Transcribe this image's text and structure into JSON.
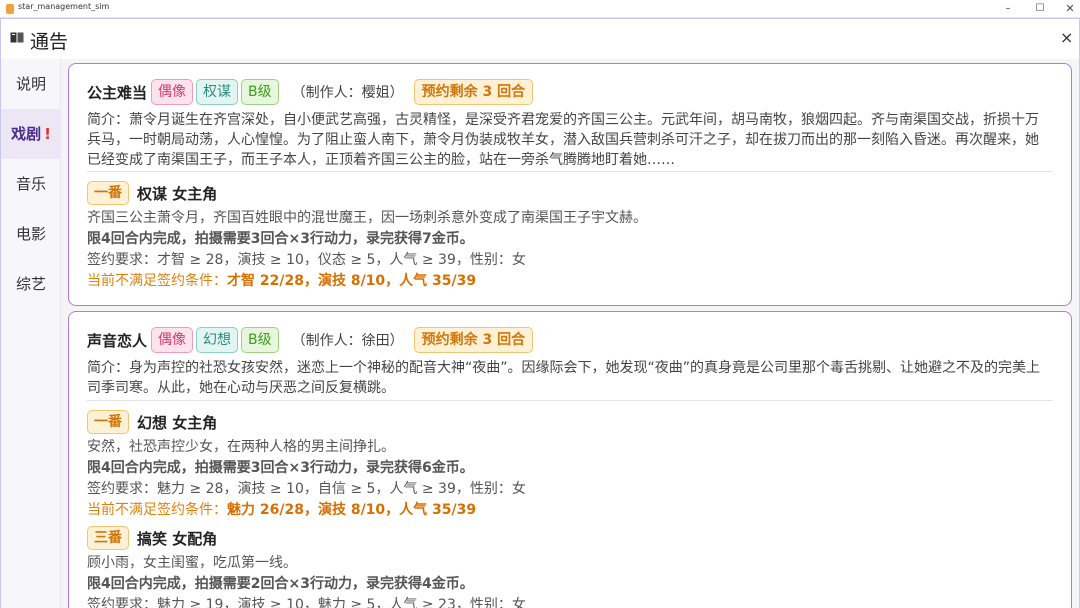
{
  "window": {
    "title": "star_management_sim",
    "minimize": "–",
    "maximize": "☐",
    "close": "✕"
  },
  "header": {
    "title": "通告",
    "close": "×"
  },
  "sidebar": {
    "items": [
      {
        "label": "说明"
      },
      {
        "label": "戏剧",
        "alert": "!"
      },
      {
        "label": "音乐"
      },
      {
        "label": "电影"
      },
      {
        "label": "综艺"
      }
    ]
  },
  "cards": [
    {
      "title": "公主难当",
      "tags": [
        "偶像",
        "权谋",
        "B级"
      ],
      "maker": "（制作人：樱姐）",
      "reserve": "预约剩余 3 回合",
      "description": "简介：萧令月诞生在齐宫深处，自小便武艺高强，古灵精怪，是深受齐君宠爱的齐国三公主。元武年间，胡马南牧，狼烟四起。齐与南渠国交战，折损十万兵马，一时朝局动荡，人心惶惶。为了阻止蛮人南下，萧令月伪装成牧羊女，潜入敌国兵营刺杀可汗之子，却在拔刀而出的那一刻陷入昏迷。再次醒来，她已经变成了南渠国王子，而王子本人，正顶着齐国三公主的脸，站在一旁杀气腾腾地盯着她……",
      "roles": [
        {
          "rank": "一番",
          "title": "权谋 女主角",
          "desc": "齐国三公主萧令月，齐国百姓眼中的混世魔王，因一场刺杀意外变成了南渠国王子宇文赫。",
          "terms": "限4回合内完成，拍摄需要3回合×3行动力，录完获得7金币。",
          "requirements": "签约要求：才智 ≥ 28，演技 ≥ 10，仪态 ≥ 5，人气 ≥ 39，性别：女",
          "unmet_prefix": "当前不满足签约条件：",
          "unmet_values": "才智 22/28，演技 8/10，人气 35/39"
        }
      ]
    },
    {
      "title": "声音恋人",
      "tags": [
        "偶像",
        "幻想",
        "B级"
      ],
      "maker": "（制作人：徐田）",
      "reserve": "预约剩余 3 回合",
      "description": "简介：身为声控的社恐女孩安然，迷恋上一个神秘的配音大神“夜曲”。因缘际会下，她发现“夜曲”的真身竟是公司里那个毒舌挑剔、让她避之不及的完美上司季司寒。从此，她在心动与厌恶之间反复横跳。",
      "roles": [
        {
          "rank": "一番",
          "title": "幻想 女主角",
          "desc": "安然，社恐声控少女，在两种人格的男主间挣扎。",
          "terms": "限4回合内完成，拍摄需要3回合×3行动力，录完获得6金币。",
          "requirements": "签约要求：魅力 ≥ 28，演技 ≥ 10，自信 ≥ 5，人气 ≥ 39，性别：女",
          "unmet_prefix": "当前不满足签约条件：",
          "unmet_values": "魅力 26/28，演技 8/10，人气 35/39"
        },
        {
          "rank": "三番",
          "title": "搞笑 女配角",
          "desc": "顾小雨，女主闺蜜，吃瓜第一线。",
          "terms": "限4回合内完成，拍摄需要2回合×3行动力，录完获得4金币。",
          "requirements": "签约要求：魅力 ≥ 19，演技 ≥ 10，魅力 ≥ 5，人气 ≥ 23，性别：女"
        }
      ]
    }
  ]
}
